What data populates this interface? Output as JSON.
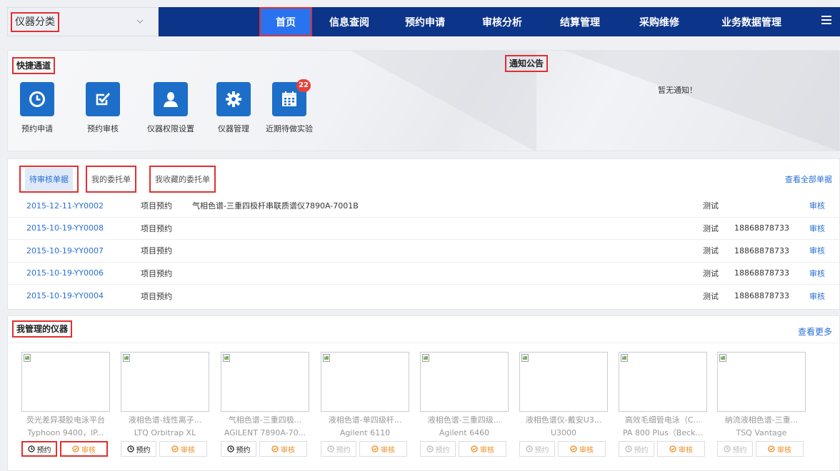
{
  "topbar": {
    "category_label": "仪器分类",
    "nav": [
      "首页",
      "信息查阅",
      "预约申请",
      "审核分析",
      "结算管理",
      "采购维修",
      "业务数据管理"
    ]
  },
  "quick": {
    "title": "快捷通道",
    "items": [
      {
        "label": "预约申请",
        "icon": "clock-icon"
      },
      {
        "label": "预约审核",
        "icon": "check-square-icon"
      },
      {
        "label": "仪器权限设置",
        "icon": "user-icon"
      },
      {
        "label": "仪器管理",
        "icon": "gear-icon"
      },
      {
        "label": "近期待做实验",
        "icon": "calendar-icon",
        "badge": "22"
      }
    ]
  },
  "notice": {
    "title": "通知公告",
    "empty_text": "暂无通知！"
  },
  "orders": {
    "tabs": [
      "待审核单据",
      "我的委托单",
      "我收藏的委托单"
    ],
    "view_all": "查看全部单据",
    "rows": [
      {
        "id": "2015-12-11-YY0002",
        "type": "项目预约",
        "instrument": "气相色谱-三重四极杆串联质谱仪7890A-7001B",
        "user": "测试",
        "phone": "",
        "action": "审核"
      },
      {
        "id": "2015-10-19-YY0008",
        "type": "项目预约",
        "instrument": "",
        "user": "测试",
        "phone": "18868878733",
        "action": "审核"
      },
      {
        "id": "2015-10-19-YY0007",
        "type": "项目预约",
        "instrument": "",
        "user": "测试",
        "phone": "18868878733",
        "action": "审核"
      },
      {
        "id": "2015-10-19-YY0006",
        "type": "项目预约",
        "instrument": "",
        "user": "测试",
        "phone": "18868878733",
        "action": "审核"
      },
      {
        "id": "2015-10-19-YY0004",
        "type": "项目预约",
        "instrument": "",
        "user": "测试",
        "phone": "18868878733",
        "action": "审核"
      }
    ]
  },
  "instruments": {
    "title": "我管理的仪器",
    "view_more": "查看更多",
    "book_label": "预约",
    "review_label": "审核",
    "cards": [
      {
        "name": "荧光差异凝胶电泳平台",
        "model": "Typhoon 9400，IP...",
        "book_enabled": true
      },
      {
        "name": "液相色谱-线性离子...",
        "model": "LTQ Orbitrap XL",
        "book_enabled": true
      },
      {
        "name": "气相色谱-三重四极...",
        "model": "AGILENT 7890A-70...",
        "book_enabled": true
      },
      {
        "name": "液相色谱-单四级杆...",
        "model": "Agilent 6110",
        "book_enabled": false
      },
      {
        "name": "液相色谱-三重四级...",
        "model": "Agilent 6460",
        "book_enabled": false
      },
      {
        "name": "液相色谱仪-戴安U3...",
        "model": "U3000",
        "book_enabled": false
      },
      {
        "name": "高效毛细管电泳（C...",
        "model": "PA 800 Plus（Beck...",
        "book_enabled": false
      },
      {
        "name": "纳流液相色谱-三重...",
        "model": "TSQ Vantage",
        "book_enabled": false
      }
    ]
  },
  "colors": {
    "nav_bg": "#0c3488",
    "nav_active": "#2a73f0",
    "tile_blue": "#1d6ec9",
    "link_blue": "#2a6fd6",
    "review_orange": "#f08a20",
    "highlight_red": "#e03030"
  }
}
